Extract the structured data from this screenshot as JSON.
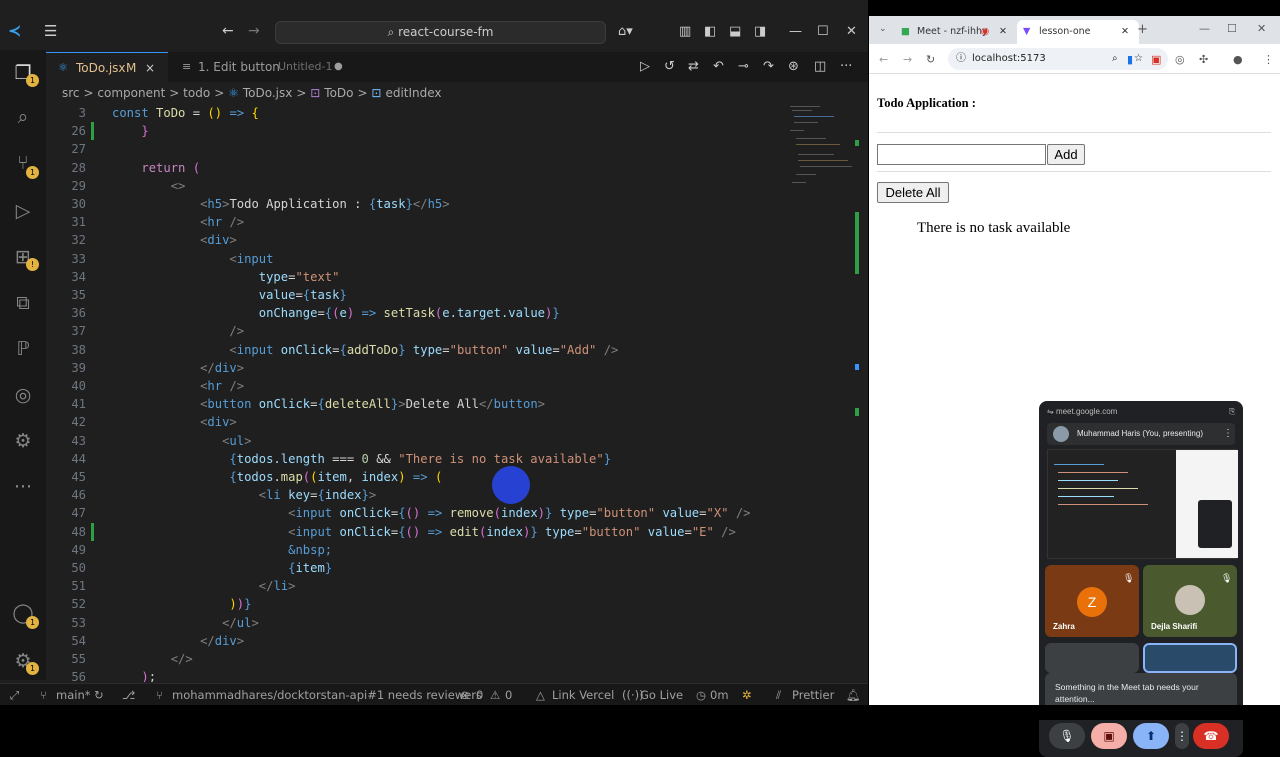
{
  "vscode": {
    "search_text": "react-course-fm",
    "tabs": [
      {
        "label": "ToDo.jsx",
        "suffix": "M",
        "close": "×"
      },
      {
        "label": "1. Edit button",
        "suffix": "Untitled-1",
        "dot": "●"
      }
    ],
    "breadcrumb": [
      "src",
      "component",
      "todo",
      "ToDo.jsx",
      "ToDo",
      "editIndex"
    ],
    "badges": {
      "explorer": "1",
      "scm": "1",
      "remote_warning": "!",
      "accounts": "1",
      "settings": "1"
    },
    "code_lines": [
      {
        "n": "3",
        "html": "<span class='tn'>const</span> <span class='fn'>ToDo</span> <span class='tx'>=</span> <span class='br'>()</span> <span class='kb'>=&gt;</span> <span class='br'>{</span>"
      },
      {
        "n": "26",
        "html": "    <span class='br2'>}</span>"
      },
      {
        "n": "27",
        "html": ""
      },
      {
        "n": "28",
        "html": "    <span class='kw'>return</span> <span class='br2'>(</span>"
      },
      {
        "n": "29",
        "html": "        <span class='t'>&lt;&gt;</span>"
      },
      {
        "n": "30",
        "html": "            <span class='t'>&lt;</span><span class='tn'>h5</span><span class='t'>&gt;</span><span class='tx'>Todo Application : </span><span class='kb'>{</span><span class='vr'>task</span><span class='kb'>}</span><span class='t'>&lt;/</span><span class='tn'>h5</span><span class='t'>&gt;</span>"
      },
      {
        "n": "31",
        "html": "            <span class='t'>&lt;</span><span class='tn'>hr</span> <span class='t'>/&gt;</span>"
      },
      {
        "n": "32",
        "html": "            <span class='t'>&lt;</span><span class='tn'>div</span><span class='t'>&gt;</span>"
      },
      {
        "n": "33",
        "html": "                <span class='t'>&lt;</span><span class='tn'>input</span>"
      },
      {
        "n": "34",
        "html": "                    <span class='at'>type</span><span class='tx'>=</span><span class='st'>\"text\"</span>"
      },
      {
        "n": "35",
        "html": "                    <span class='at'>value</span><span class='tx'>=</span><span class='kb'>{</span><span class='vr'>task</span><span class='kb'>}</span>"
      },
      {
        "n": "36",
        "html": "                    <span class='at'>onChange</span><span class='tx'>=</span><span class='kb'>{</span><span class='br2'>(</span><span class='vr'>e</span><span class='br2'>)</span> <span class='kb'>=&gt;</span> <span class='fn'>setTask</span><span class='br2'>(</span><span class='vr'>e.target.value</span><span class='br2'>)</span><span class='kb'>}</span>"
      },
      {
        "n": "37",
        "html": "                <span class='t'>/&gt;</span>"
      },
      {
        "n": "38",
        "html": "                <span class='t'>&lt;</span><span class='tn'>input</span> <span class='at'>onClick</span><span class='tx'>=</span><span class='kb'>{</span><span class='fn'>addToDo</span><span class='kb'>}</span> <span class='at'>type</span><span class='tx'>=</span><span class='st'>\"button\"</span> <span class='at'>value</span><span class='tx'>=</span><span class='st'>\"Add\"</span> <span class='t'>/&gt;</span>"
      },
      {
        "n": "39",
        "html": "            <span class='t'>&lt;/</span><span class='tn'>div</span><span class='t'>&gt;</span>"
      },
      {
        "n": "40",
        "html": "            <span class='t'>&lt;</span><span class='tn'>hr</span> <span class='t'>/&gt;</span>"
      },
      {
        "n": "41",
        "html": "            <span class='t'>&lt;</span><span class='tn'>button</span> <span class='at'>onClick</span><span class='tx'>=</span><span class='kb'>{</span><span class='fn'>deleteAll</span><span class='kb'>}</span><span class='t'>&gt;</span><span class='tx'>Delete All</span><span class='t'>&lt;/</span><span class='tn'>button</span><span class='t'>&gt;</span>"
      },
      {
        "n": "42",
        "html": "            <span class='t'>&lt;</span><span class='tn'>div</span><span class='t'>&gt;</span>"
      },
      {
        "n": "43",
        "html": "               <span class='t'>&lt;</span><span class='tn'>ul</span><span class='t'>&gt;</span>"
      },
      {
        "n": "44",
        "html": "                <span class='kb'>{</span><span class='vr'>todos.length</span> <span class='tx'>===</span> <span class='nm'>0</span> <span class='tx'>&amp;&amp;</span> <span class='st'>\"There is no task available\"</span><span class='kb'>}</span>"
      },
      {
        "n": "45",
        "html": "                <span class='kb'>{</span><span class='vr'>todos</span><span class='tx'>.</span><span class='fn'>map</span><span class='br2'>(</span><span class='br'>(</span><span class='vr'>item</span><span class='tx'>,</span> <span class='vr'>index</span><span class='br'>)</span> <span class='kb'>=&gt;</span> <span class='br'>(</span>"
      },
      {
        "n": "46",
        "html": "                    <span class='t'>&lt;</span><span class='tn'>li</span> <span class='at'>key</span><span class='tx'>=</span><span class='kb'>{</span><span class='vr'>index</span><span class='kb'>}</span><span class='t'>&gt;</span>"
      },
      {
        "n": "47",
        "html": "                        <span class='t'>&lt;</span><span class='tn'>input</span> <span class='at'>onClick</span><span class='tx'>=</span><span class='kb'>{</span><span class='br2'>()</span> <span class='kb'>=&gt;</span> <span class='fn'>remove</span><span class='br2'>(</span><span class='vr'>index</span><span class='br2'>)</span><span class='kb'>}</span> <span class='at'>type</span><span class='tx'>=</span><span class='st'>\"button\"</span> <span class='at'>value</span><span class='tx'>=</span><span class='st'>\"X\"</span> <span class='t'>/&gt;</span>"
      },
      {
        "n": "48",
        "html": "                        <span class='t'>&lt;</span><span class='tn'>input</span> <span class='at'>onClick</span><span class='tx'>=</span><span class='kb'>{</span><span class='br2'>()</span> <span class='kb'>=&gt;</span> <span class='fn'>edit</span><span class='br2'>(</span><span class='vr'>index</span><span class='br2'>)</span><span class='kb'>}</span> <span class='at'>type</span><span class='tx'>=</span><span class='st'>\"button\"</span> <span class='at'>value</span><span class='tx'>=</span><span class='st'>\"E\"</span> <span class='t'>/&gt;</span>"
      },
      {
        "n": "49",
        "html": "                        <span class='tn'>&amp;nbsp;</span>"
      },
      {
        "n": "50",
        "html": "                        <span class='kb'>{</span><span class='vr'>item</span><span class='kb'>}</span>"
      },
      {
        "n": "51",
        "html": "                    <span class='t'>&lt;/</span><span class='tn'>li</span><span class='t'>&gt;</span>"
      },
      {
        "n": "52",
        "html": "                <span class='br'>)</span><span class='br2'>)</span><span class='kb'>}</span>"
      },
      {
        "n": "53",
        "html": "               <span class='t'>&lt;/</span><span class='tn'>ul</span><span class='t'>&gt;</span>"
      },
      {
        "n": "54",
        "html": "            <span class='t'>&lt;/</span><span class='tn'>div</span><span class='t'>&gt;</span>"
      },
      {
        "n": "55",
        "html": "        <span class='t'>&lt;/&gt;</span>"
      },
      {
        "n": "56",
        "html": "    <span class='br2'>)</span><span class='tx'>;</span>"
      }
    ],
    "modified_lines": [
      "26",
      "48"
    ],
    "status": {
      "branch": "main*",
      "pr": "mohammadhares/docktorstan-api#1 needs reviewers",
      "errors": "0",
      "warnings": "0",
      "link": "Link Vercel",
      "golive": "Go Live",
      "time": "0m",
      "prettier": "Prettier"
    }
  },
  "chrome": {
    "tabs": [
      {
        "label": "Meet - nzf-ihhy"
      },
      {
        "label": "lesson-one"
      }
    ],
    "url": "localhost:5173",
    "page": {
      "heading": "Todo Application :",
      "add_label": "Add",
      "delete_label": "Delete All",
      "empty_text": "There is no task available"
    },
    "meet": {
      "url": "meet.google.com",
      "presenter": "Muhammad Haris (You, presenting)",
      "participants": [
        {
          "name": "Zahra",
          "initial": "Z"
        },
        {
          "name": "Dejla Sharifi"
        }
      ],
      "toast": "Something in the Meet tab needs your attention..."
    }
  }
}
